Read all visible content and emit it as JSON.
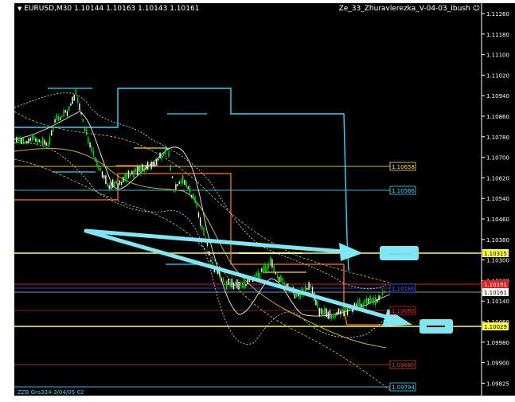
{
  "header": {
    "symbol": "EURUSD,M30",
    "ohlc": "1.10144 1.10163 1.10143 1.10161",
    "indicator": "Ze_33_Zhuravlerezka_V-04-03_Ibush"
  },
  "footer_label": "ZZB Gra334-3/04/05-02",
  "colors": {
    "background": "#000000",
    "candle": "#00e000",
    "yellow": "#ffff40",
    "cyan": "#33d6ff",
    "orange": "#ff7a1a",
    "red": "#e02020",
    "arrow": "#7fe6f2"
  },
  "price_axis": {
    "ticks": [
      "1.11260",
      "1.11180",
      "1.11100",
      "1.11020",
      "1.10940",
      "1.10860",
      "1.10780",
      "1.10700",
      "1.10620",
      "1.10540",
      "1.10460",
      "1.10380",
      "1.10300",
      "1.10220",
      "1.10140",
      "1.10060",
      "1.09980",
      "1.09900",
      "1.09825"
    ],
    "current_price": "1.10161",
    "highlight_labels": [
      {
        "text": "1.10315",
        "color": "#ffff40"
      },
      {
        "text": "1.10191",
        "color": "#e02020"
      },
      {
        "text": "1.10161",
        "color": "#ffffff"
      },
      {
        "text": "1.10029",
        "color": "#ffff40"
      }
    ]
  },
  "level_labels": [
    {
      "text": "1.10658",
      "color": "#ffd85a"
    },
    {
      "text": "1.10566",
      "color": "#33d6ff"
    },
    {
      "text": "1.10180",
      "color": "#4060ff"
    },
    {
      "text": "1.10088",
      "color": "#e02020"
    },
    {
      "text": "1.09880",
      "color": "#c04020"
    },
    {
      "text": "1.09794",
      "color": "#33d6ff"
    }
  ]
}
